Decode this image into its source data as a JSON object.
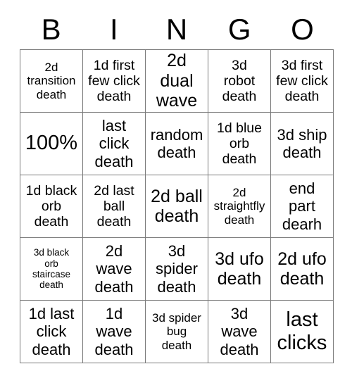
{
  "card": {
    "title": "BINGO",
    "header_letters": [
      "B",
      "I",
      "N",
      "G",
      "O"
    ],
    "grid_columns": 5,
    "grid_rows": 5,
    "colors": {
      "background": "#ffffff",
      "text": "#000000",
      "grid_line": "#7a7a7a"
    },
    "cells": [
      {
        "text": "2d\ntransition\ndeath",
        "size": "sm"
      },
      {
        "text": "1d first\nfew click\ndeath",
        "size": "md"
      },
      {
        "text": "2d dual\nwave",
        "size": "xl"
      },
      {
        "text": "3d\nrobot\ndeath",
        "size": "md"
      },
      {
        "text": "3d first\nfew click\ndeath",
        "size": "md"
      },
      {
        "text": "100%",
        "size": "xxl"
      },
      {
        "text": "last\nclick\ndeath",
        "size": "lg"
      },
      {
        "text": "random\ndeath",
        "size": "lg"
      },
      {
        "text": "1d blue\norb\ndeath",
        "size": "md"
      },
      {
        "text": "3d ship\ndeath",
        "size": "lg"
      },
      {
        "text": "1d black\norb\ndeath",
        "size": "md"
      },
      {
        "text": "2d last\nball\ndeath",
        "size": "md"
      },
      {
        "text": "2d ball\ndeath",
        "size": "xl"
      },
      {
        "text": "2d\nstraightfly\ndeath",
        "size": "sm"
      },
      {
        "text": "end\npart\ndearh",
        "size": "lg"
      },
      {
        "text": "3d black\norb\nstaircase\ndeath",
        "size": "xs"
      },
      {
        "text": "2d\nwave\ndeath",
        "size": "lg"
      },
      {
        "text": "3d\nspider\ndeath",
        "size": "lg"
      },
      {
        "text": "3d ufo\ndeath",
        "size": "xl"
      },
      {
        "text": "2d ufo\ndeath",
        "size": "xl"
      },
      {
        "text": "1d last\nclick\ndeath",
        "size": "lg"
      },
      {
        "text": "1d\nwave\ndeath",
        "size": "lg"
      },
      {
        "text": "3d spider\nbug\ndeath",
        "size": "sm"
      },
      {
        "text": "3d\nwave\ndeath",
        "size": "lg"
      },
      {
        "text": "last\nclicks",
        "size": "xxl"
      }
    ]
  }
}
